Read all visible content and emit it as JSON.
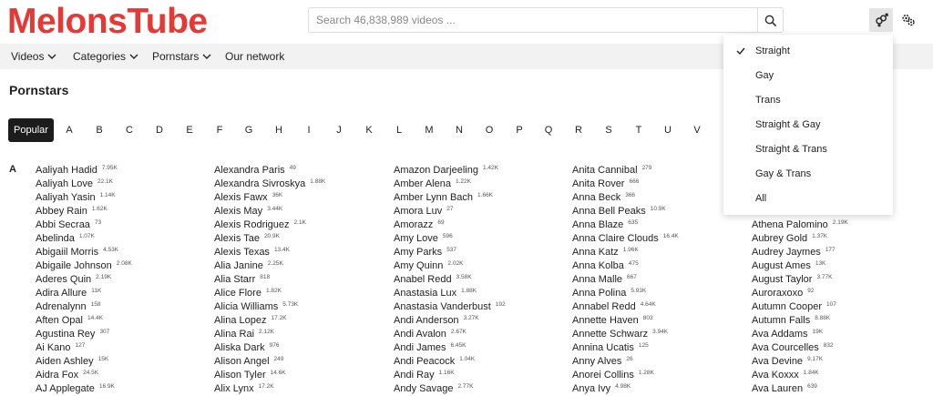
{
  "header": {
    "logo": "MelonsTube",
    "search_placeholder": "Search 46,838,989 videos ..."
  },
  "nav": {
    "items": [
      {
        "label": "Videos",
        "has_dropdown": true
      },
      {
        "label": "Categories",
        "has_dropdown": true
      },
      {
        "label": "Pornstars",
        "has_dropdown": true
      },
      {
        "label": "Our network",
        "has_dropdown": false
      }
    ]
  },
  "page_title": "Pornstars",
  "letters": [
    "Popular",
    "A",
    "B",
    "C",
    "D",
    "E",
    "F",
    "G",
    "H",
    "I",
    "J",
    "K",
    "L",
    "M",
    "N",
    "O",
    "P",
    "Q",
    "R",
    "S",
    "T",
    "U",
    "V"
  ],
  "group_letter": "A",
  "columns": [
    [
      {
        "name": "Aaliyah Hadid",
        "count": "7.95K"
      },
      {
        "name": "Aaliyah Love",
        "count": "22.1K"
      },
      {
        "name": "Aaliyah Yasin",
        "count": "1.14K"
      },
      {
        "name": "Abbey Rain",
        "count": "1.62K"
      },
      {
        "name": "Abbi Secraa",
        "count": "73"
      },
      {
        "name": "Abelinda",
        "count": "1.07K"
      },
      {
        "name": "Abigaiil Morris",
        "count": "4.53K"
      },
      {
        "name": "Abigaile Johnson",
        "count": "2.08K"
      },
      {
        "name": "Aderes Quin",
        "count": "2.19K"
      },
      {
        "name": "Adira Allure",
        "count": "11K"
      },
      {
        "name": "Adrenalynn",
        "count": "158"
      },
      {
        "name": "Aften Opal",
        "count": "14.4K"
      },
      {
        "name": "Agustina Rey",
        "count": "307"
      },
      {
        "name": "Ai Kano",
        "count": "127"
      },
      {
        "name": "Aiden Ashley",
        "count": "15K"
      },
      {
        "name": "Aidra Fox",
        "count": "24.5K"
      },
      {
        "name": "AJ Applegate",
        "count": "16.9K"
      }
    ],
    [
      {
        "name": "Alexandra Paris",
        "count": "49"
      },
      {
        "name": "Alexandra Sivroskya",
        "count": "1.88K"
      },
      {
        "name": "Alexis Fawx",
        "count": "36K"
      },
      {
        "name": "Alexis May",
        "count": "3.44K"
      },
      {
        "name": "Alexis Rodriguez",
        "count": "2.1K"
      },
      {
        "name": "Alexis Tae",
        "count": "20.9K"
      },
      {
        "name": "Alexis Texas",
        "count": "13.4K"
      },
      {
        "name": "Alia Janine",
        "count": "2.25K"
      },
      {
        "name": "Alia Starr",
        "count": "818"
      },
      {
        "name": "Alice Flore",
        "count": "1.82K"
      },
      {
        "name": "Alicia Williams",
        "count": "5.73K"
      },
      {
        "name": "Alina Lopez",
        "count": "17.2K"
      },
      {
        "name": "Alina Rai",
        "count": "2.12K"
      },
      {
        "name": "Aliska Dark",
        "count": "976"
      },
      {
        "name": "Alison Angel",
        "count": "249"
      },
      {
        "name": "Alison Tyler",
        "count": "14.6K"
      },
      {
        "name": "Alix Lynx",
        "count": "17.2K"
      }
    ],
    [
      {
        "name": "Amazon Darjeeling",
        "count": "1.42K"
      },
      {
        "name": "Amber Alena",
        "count": "1.22K"
      },
      {
        "name": "Amber Lynn Bach",
        "count": "1.66K"
      },
      {
        "name": "Amora Luv",
        "count": "27"
      },
      {
        "name": "Amorazz",
        "count": "69"
      },
      {
        "name": "Amy Love",
        "count": "596"
      },
      {
        "name": "Amy Parks",
        "count": "537"
      },
      {
        "name": "Amy Quinn",
        "count": "2.02K"
      },
      {
        "name": "Anabel Redd",
        "count": "3.58K"
      },
      {
        "name": "Anastasia Lux",
        "count": "1.88K"
      },
      {
        "name": "Anastasia Vanderbust",
        "count": "192"
      },
      {
        "name": "Andi Anderson",
        "count": "3.27K"
      },
      {
        "name": "Andi Avalon",
        "count": "2.67K"
      },
      {
        "name": "Andi James",
        "count": "6.45K"
      },
      {
        "name": "Andi Peacock",
        "count": "1.04K"
      },
      {
        "name": "Andi Ray",
        "count": "1.16K"
      },
      {
        "name": "Andy Savage",
        "count": "2.77K"
      }
    ],
    [
      {
        "name": "Anita Cannibal",
        "count": "279"
      },
      {
        "name": "Anita Rover",
        "count": "666"
      },
      {
        "name": "Anna Beck",
        "count": "366"
      },
      {
        "name": "Anna Bell Peaks",
        "count": "10.9K"
      },
      {
        "name": "Anna Blaze",
        "count": "635"
      },
      {
        "name": "Anna Claire Clouds",
        "count": "16.4K"
      },
      {
        "name": "Anna Katz",
        "count": "1.96K"
      },
      {
        "name": "Anna Kolba",
        "count": "475"
      },
      {
        "name": "Anna Malle",
        "count": "667"
      },
      {
        "name": "Anna Polina",
        "count": "5.93K"
      },
      {
        "name": "Annabel Redd",
        "count": "4.64K"
      },
      {
        "name": "Annette Haven",
        "count": "803"
      },
      {
        "name": "Annette Schwarz",
        "count": "3.94K"
      },
      {
        "name": "Annina Ucatis",
        "count": "125"
      },
      {
        "name": "Anny Alves",
        "count": "26"
      },
      {
        "name": "Anorei Collins",
        "count": "1.28K"
      },
      {
        "name": "Anya Ivy",
        "count": "4.98K"
      }
    ],
    [
      {
        "name": "Athena Palomino",
        "count": "2.19K"
      },
      {
        "name": "Aubrey Gold",
        "count": "1.37K"
      },
      {
        "name": "Audrey Jaymes",
        "count": "177"
      },
      {
        "name": "August Ames",
        "count": "13K"
      },
      {
        "name": "August Taylor",
        "count": "3.77K"
      },
      {
        "name": "Auroraxoxo",
        "count": "92"
      },
      {
        "name": "Autumn Cooper",
        "count": "107"
      },
      {
        "name": "Autumn Falls",
        "count": "8.88K"
      },
      {
        "name": "Ava Addams",
        "count": "19K"
      },
      {
        "name": "Ava Courcelles",
        "count": "832"
      },
      {
        "name": "Ava Devine",
        "count": "9.17K"
      },
      {
        "name": "Ava Koxxx",
        "count": "1.84K"
      },
      {
        "name": "Ava Lauren",
        "count": "639"
      }
    ]
  ],
  "orientation_menu": {
    "selected": "Straight",
    "options": [
      "Straight",
      "Gay",
      "Trans",
      "Straight & Gay",
      "Straight & Trans",
      "Gay & Trans",
      "All"
    ]
  },
  "colors": {
    "logo": "#e53935",
    "nav_bg": "#f2f2f2",
    "selected_letter_bg": "#1c1c1c"
  }
}
